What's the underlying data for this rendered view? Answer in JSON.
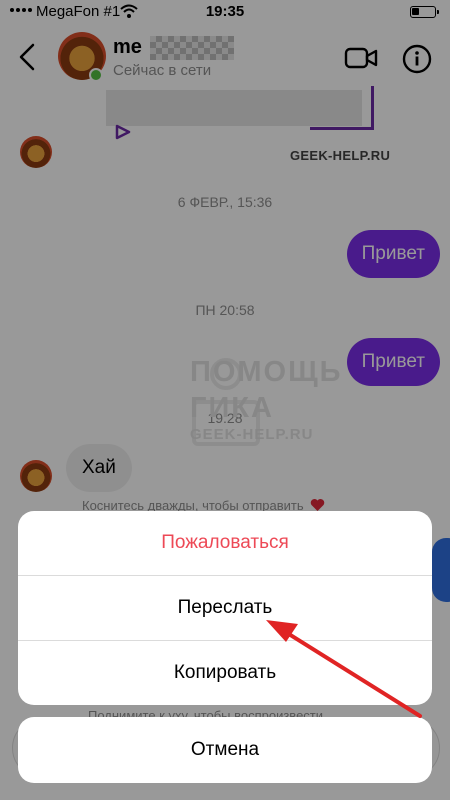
{
  "status_bar": {
    "carrier": "MegaFon #1",
    "time": "19:35",
    "battery_level": 0.35
  },
  "header": {
    "contact_name": "me",
    "contact_status": "Сейчас в сети"
  },
  "chat": {
    "watermark_small": "GEEK-HELP.RU",
    "timestamps": [
      "6 ФЕВР., 15:36",
      "ПН 20:58",
      "19:28"
    ],
    "outgoing": [
      "Привет",
      "Привет"
    ],
    "incoming": [
      "Хай"
    ],
    "double_tap_hint": "Коснитесь дважды, чтобы отправить",
    "raise_hint": "Поднимите к уху, чтобы воспроизвести"
  },
  "watermark": {
    "line1": "ПОМОЩЬ",
    "line2": "ГИКА",
    "line3": "GEEK-HELP.RU"
  },
  "action_sheet": {
    "report": "Пожаловаться",
    "forward": "Переслать",
    "copy": "Копировать",
    "cancel": "Отмена"
  },
  "colors": {
    "accent": "#7a2de8",
    "danger": "#ed4956",
    "online": "#54c043",
    "arrow": "#e02424"
  }
}
